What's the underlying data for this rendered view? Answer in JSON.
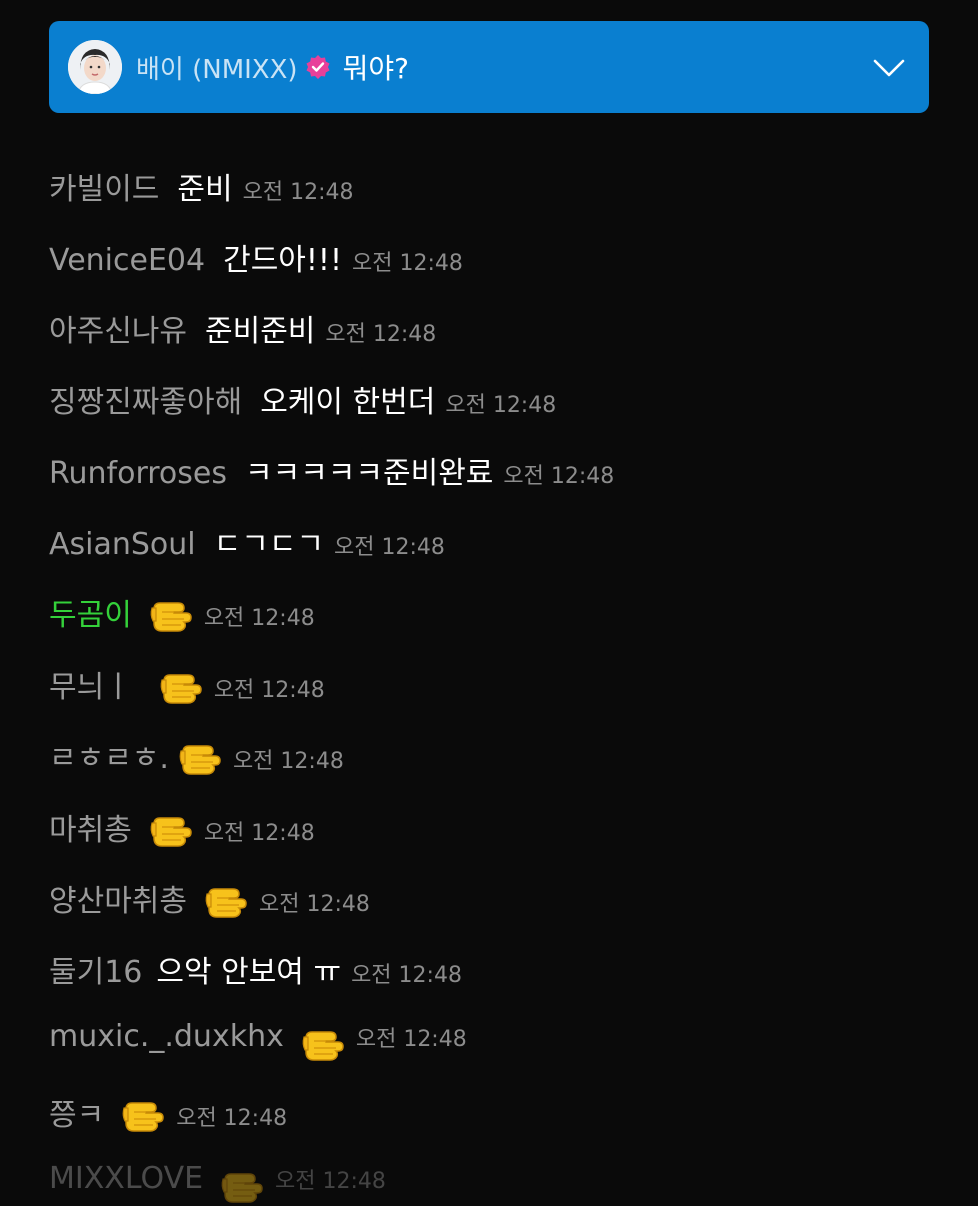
{
  "pinned": {
    "name": "배이 (NMIXX)",
    "message": "뭐야?",
    "verified_color": "#e8409a",
    "accent": "#0a7fd0"
  },
  "messages": [
    {
      "user": "카빌이드",
      "text": "준비",
      "time": "오전 12:48"
    },
    {
      "user": "VeniceE04",
      "text": "간드아!!!",
      "time": "오전 12:48"
    },
    {
      "user": "아주신나유",
      "text": "준비준비",
      "time": "오전 12:48"
    },
    {
      "user": "징짱진짜좋아해",
      "text": "오케이 한번더",
      "time": "오전 12:48"
    },
    {
      "user": "Runforroses",
      "text": "ㅋㅋㅋㅋㅋ준비완료",
      "time": "오전 12:48"
    },
    {
      "user": "AsianSoul",
      "text": "ㄷㄱㄷㄱ",
      "time": "오전 12:48"
    },
    {
      "user": "두곰이",
      "text": "",
      "emoji": "pointing-fist-icon",
      "time": "오전 12:48",
      "user_color": "#34d13a"
    },
    {
      "user": "무늬ㅣ",
      "text": "",
      "emoji": "pointing-fist-icon",
      "time": "오전 12:48"
    },
    {
      "user": "ㄹㅎㄹㅎ.",
      "text": "",
      "emoji": "pointing-fist-icon",
      "time": "오전 12:48"
    },
    {
      "user": "마취총",
      "text": "",
      "emoji": "pointing-fist-icon",
      "time": "오전 12:48"
    },
    {
      "user": "양산마취총",
      "text": "",
      "emoji": "pointing-fist-icon",
      "time": "오전 12:48"
    },
    {
      "user": "둘기16",
      "text": "으악 안보여 ㅠ",
      "time": "오전 12:48"
    },
    {
      "user": "muxic._.duxkhx",
      "text": "",
      "emoji": "pointing-fist-icon",
      "time": "오전 12:48"
    },
    {
      "user": "쯩ㅋ",
      "text": "",
      "emoji": "pointing-fist-icon",
      "time": "오전 12:48"
    },
    {
      "user": "MIXXLOVE",
      "text": "",
      "emoji": "pointing-fist-icon",
      "time": "오전 12:48"
    }
  ]
}
